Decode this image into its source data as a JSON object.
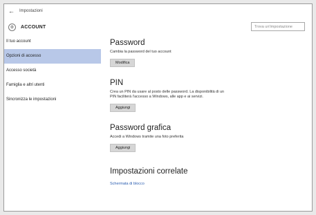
{
  "titlebar": {
    "back_icon": "back-arrow-icon",
    "title": "Impostazioni"
  },
  "header": {
    "icon": "gear-icon",
    "title": "ACCOUNT",
    "search_placeholder": "Trova un'impostazione"
  },
  "sidebar": {
    "items": [
      {
        "label": "Il tuo account",
        "selected": false
      },
      {
        "label": "Opzioni di accesso",
        "selected": true
      },
      {
        "label": "Accesso società",
        "selected": false
      },
      {
        "label": "Famiglia e altri utenti",
        "selected": false
      },
      {
        "label": "Sincronizza le impostazioni",
        "selected": false
      }
    ]
  },
  "sections": {
    "password": {
      "title": "Password",
      "description": "Cambia la password del tuo account",
      "button": "Modifica"
    },
    "pin": {
      "title": "PIN",
      "description_line1": "Crea un PIN da usare al posto delle password. La disponibilità di un",
      "description_line2": "PIN faciliterà l'accesso a Windows, alle app e ai servizi.",
      "button": "Aggiungi"
    },
    "picture_password": {
      "title": "Password grafica",
      "description": "Accedi a Windows tramite una foto preferita",
      "button": "Aggiungi"
    },
    "related": {
      "title": "Impostazioni correlate",
      "link": "Schermata di blocco"
    }
  },
  "colors": {
    "selected_item": "#b8c8e8",
    "link": "#2a5db0",
    "button": "#d6d6d6"
  }
}
